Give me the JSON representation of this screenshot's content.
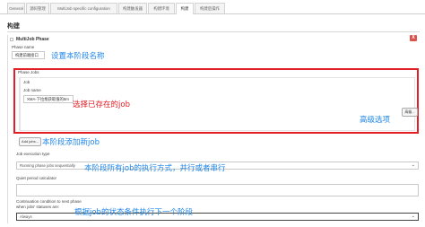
{
  "tabs": [
    "General",
    "源码管理",
    "MultiJob specific configuration",
    "构建触发器",
    "构建环境",
    "构建",
    "构建后操作"
  ],
  "active_tab": 5,
  "section_title": "构建",
  "phase": {
    "title": "MultiJob Phase",
    "delete_label": "X",
    "name_label": "Phase name",
    "name_value": "构建前端接口",
    "jobs_label": "Phase Jobs",
    "job_section_label": "Job",
    "job_name_label": "Job name",
    "job_name_value": "XMA-下拉框获取值的5m",
    "advanced_button": "高级...",
    "add_jobs_button": "Add jobs...",
    "execution_label": "Job execution type",
    "execution_value": "Running phase jobs sequentially",
    "quiet_label": "Quiet period calculator",
    "continuation_label": "Continuation condition to next phase",
    "continuation_sub": "when jobs' statuses are:",
    "continuation_value": "Always"
  },
  "annotations": {
    "set_name": "设置本阶段名称",
    "choose_job": "选择已存在的job",
    "advanced": "高级选项",
    "add_job": "本阶段添加新job",
    "execution": "本阶段所有job的执行方式，并行或者串行",
    "condition": "根据job的状态条件执行下一个阶段"
  },
  "colors": {
    "annotation_blue": "#1f86e8",
    "highlight_red": "#e31e24",
    "delete_red": "#d9534f"
  }
}
